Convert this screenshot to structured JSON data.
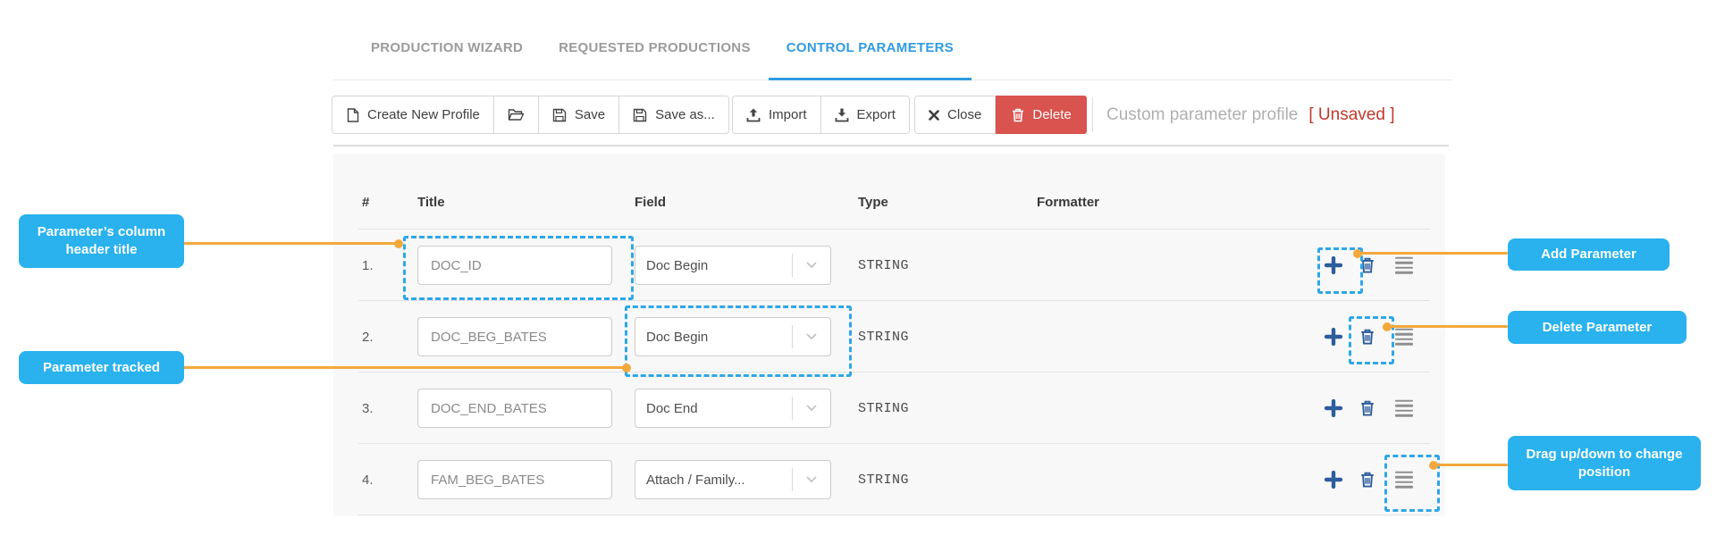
{
  "tabs": [
    {
      "label": "PRODUCTION WIZARD",
      "active": false
    },
    {
      "label": "REQUESTED PRODUCTIONS",
      "active": false
    },
    {
      "label": "CONTROL PARAMETERS",
      "active": true
    }
  ],
  "toolbar": {
    "create_new_profile": "Create New Profile",
    "save": "Save",
    "save_as": "Save as...",
    "import": "Import",
    "export": "Export",
    "close": "Close",
    "delete": "Delete",
    "profile_name": "Custom parameter profile",
    "profile_status": "[ Unsaved ]"
  },
  "table": {
    "columns": {
      "num": "#",
      "title": "Title",
      "field": "Field",
      "type": "Type",
      "formatter": "Formatter"
    },
    "rows": [
      {
        "num": "1.",
        "title": "DOC_ID",
        "field": "Doc Begin",
        "type": "STRING"
      },
      {
        "num": "2.",
        "title": "DOC_BEG_BATES",
        "field": "Doc Begin",
        "type": "STRING"
      },
      {
        "num": "3.",
        "title": "DOC_END_BATES",
        "field": "Doc End",
        "type": "STRING"
      },
      {
        "num": "4.",
        "title": "FAM_BEG_BATES",
        "field": "Attach / Family...",
        "type": "STRING"
      }
    ]
  },
  "callouts": {
    "column_header_title": "Parameter’s column header title",
    "parameter_tracked": "Parameter tracked",
    "add_parameter": "Add Parameter",
    "delete_parameter": "Delete Parameter",
    "drag_position": "Drag up/down to change position"
  },
  "icons": {
    "create_new_profile": "file-icon",
    "open_profile": "folder-open-icon",
    "save": "floppy-icon",
    "save_as": "floppy-icon",
    "import": "upload-icon",
    "export": "download-icon",
    "close": "x-icon",
    "delete": "trash-icon",
    "row_add": "plus-icon",
    "row_delete": "trash-icon",
    "row_drag": "hamburger-icon",
    "field_select": "chevron-down-icon"
  },
  "colors": {
    "active_tab": "#2f9be3",
    "inactive_tab": "#9b9b9b",
    "callout_bg": "#29b2ed",
    "highlight_dashed": "#2ea7e8",
    "connector": "#f3a83c",
    "delete_button": "#d9534f",
    "unsaved_text": "#c0392b",
    "row_icon_blue": "#2d5d9c",
    "panel_bg": "#f8f8f8"
  }
}
